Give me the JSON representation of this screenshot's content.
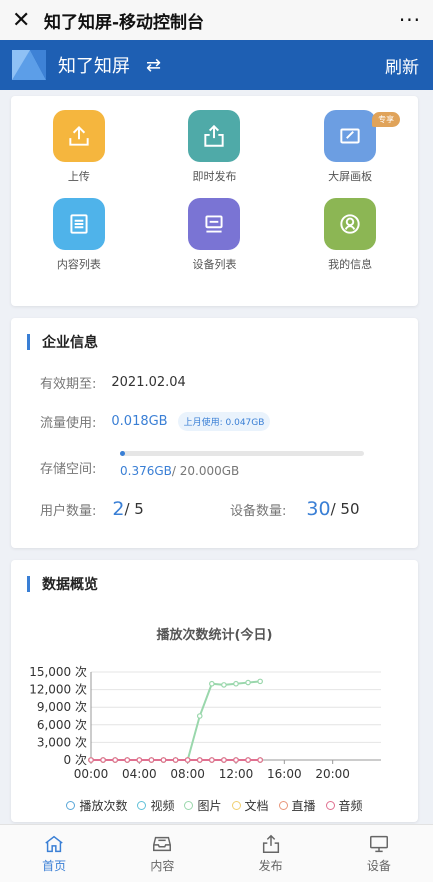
{
  "titlebar": {
    "close_icon": "close-icon",
    "title": "知了知屏-移动控制台",
    "more": "···"
  },
  "header": {
    "brand": "知了知屏",
    "swap_icon": "⇄",
    "refresh": "刷新",
    "bg": "#1e5fb3"
  },
  "quick": [
    {
      "label": "上传",
      "icon": "upload-icon",
      "color": "#f5b63e"
    },
    {
      "label": "即时发布",
      "icon": "share-icon",
      "color": "#4faaa8"
    },
    {
      "label": "大屏画板",
      "icon": "edit-board-icon",
      "color": "#6c9ee2",
      "badge": "专享"
    },
    {
      "label": "内容列表",
      "icon": "list-icon",
      "color": "#4fb3ea"
    },
    {
      "label": "设备列表",
      "icon": "device-icon",
      "color": "#7a74d4"
    },
    {
      "label": "我的信息",
      "icon": "user-icon",
      "color": "#8cb654"
    }
  ],
  "company": {
    "title": "企业信息",
    "expiry_label": "有效期至:",
    "expiry_value": "2021.02.04",
    "traffic_label": "流量使用:",
    "traffic_value": "0.018GB",
    "traffic_last_month": "上月使用: 0.047GB",
    "storage_label": "存储空间:",
    "storage_used": "0.376GB",
    "storage_total": " / 20.000GB",
    "storage_fraction": 0.0188,
    "users_label": "用户数量:",
    "users_value": "2",
    "users_max": " / 5",
    "devices_label": "设备数量:",
    "devices_value": "30",
    "devices_max": " / 50"
  },
  "overview": {
    "title": "数据概览"
  },
  "chart_data": {
    "type": "line",
    "title": "播放次数统计(今日)",
    "y_ticks": [
      "15,000 次",
      "12,000 次",
      "9,000 次",
      "6,000 次",
      "3,000 次",
      "0 次"
    ],
    "x_ticks": [
      "00:00",
      "04:00",
      "08:00",
      "12:00",
      "16:00",
      "20:00"
    ],
    "ylim": [
      0,
      15000
    ],
    "xlim": [
      0,
      24
    ],
    "x": [
      0,
      1,
      2,
      3,
      4,
      5,
      6,
      7,
      8,
      9,
      10,
      11,
      12,
      13,
      14
    ],
    "series": [
      {
        "name": "播放次数",
        "color": "#5aa7d8",
        "values": [
          0,
          0,
          0,
          0,
          0,
          0,
          0,
          0,
          0,
          0,
          0,
          0,
          0,
          0,
          0
        ]
      },
      {
        "name": "视频",
        "color": "#60c1d8",
        "values": [
          0,
          0,
          0,
          0,
          0,
          0,
          0,
          0,
          0,
          0,
          0,
          0,
          0,
          0,
          0
        ]
      },
      {
        "name": "图片",
        "color": "#9ad7ac",
        "values": [
          0,
          0,
          0,
          0,
          0,
          0,
          0,
          0,
          0,
          7500,
          13000,
          12800,
          13000,
          13200,
          13400
        ]
      },
      {
        "name": "文档",
        "color": "#f0d070",
        "values": [
          0,
          0,
          0,
          0,
          0,
          0,
          0,
          0,
          0,
          0,
          0,
          0,
          0,
          0,
          0
        ]
      },
      {
        "name": "直播",
        "color": "#e8967a",
        "values": [
          0,
          0,
          0,
          0,
          0,
          0,
          0,
          0,
          0,
          0,
          0,
          0,
          0,
          0,
          0
        ]
      },
      {
        "name": "音频",
        "color": "#e07090",
        "values": [
          0,
          0,
          0,
          0,
          0,
          0,
          0,
          0,
          0,
          0,
          0,
          0,
          0,
          0,
          0
        ]
      }
    ]
  },
  "tabs": [
    {
      "label": "首页",
      "icon": "home-icon",
      "active": true
    },
    {
      "label": "内容",
      "icon": "inbox-icon",
      "active": false
    },
    {
      "label": "发布",
      "icon": "publish-icon",
      "active": false
    },
    {
      "label": "设备",
      "icon": "monitor-icon",
      "active": false
    }
  ]
}
